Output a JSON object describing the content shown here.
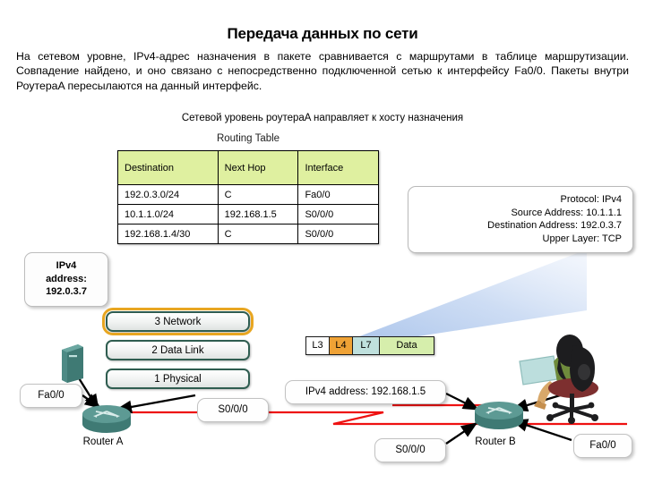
{
  "slide": {
    "title": "Передача данных по сети",
    "paragraph": "На сетевом уровне, IPv4-адрес назначения в пакете сравнивается с маршрутами в таблице маршрутизации. Совпадение найдено, и оно связано с непосредственно подключенной сетью к интерфейсу Fa0/0. Пакеты внутри РоутераA пересылаются на данный интерфейс.",
    "caption": "Сетевой уровень роутераA направляет к хосту назначения"
  },
  "routing_table": {
    "caption": "Routing Table",
    "headers": [
      "Destination",
      "Next Hop",
      "Interface"
    ],
    "rows": [
      [
        "192.0.3.0/24",
        "C",
        "Fa0/0"
      ],
      [
        "10.1.1.0/24",
        "192.168.1.5",
        "S0/0/0"
      ],
      [
        "192.168.1.4/30",
        "C",
        "S0/0/0"
      ]
    ],
    "header_color": "#dff0a0"
  },
  "packet_info": {
    "lines": [
      "Protocol: IPv4",
      "Source Address: 10.1.1.1",
      "Destination Address: 192.0.3.7",
      "Upper Layer: TCP"
    ]
  },
  "ipv4_left": {
    "line1": "IPv4",
    "line2": "address:",
    "line3": "192.0.3.7"
  },
  "osi_stack": {
    "layers": [
      {
        "label": "3 Network",
        "highlighted": true,
        "highlight_color": "#e8a621"
      },
      {
        "label": "2 Data Link",
        "highlighted": false,
        "highlight_color": ""
      },
      {
        "label": "1 Physical",
        "highlighted": false,
        "highlight_color": ""
      }
    ]
  },
  "packet_bar": {
    "segments": [
      {
        "label": "L3",
        "color": "#fefefe"
      },
      {
        "label": "L4",
        "color": "#efa235"
      },
      {
        "label": "L7",
        "color": "#bfe0dd"
      },
      {
        "label": "Data",
        "color": "#d6eeac"
      }
    ]
  },
  "labels": {
    "fa00_left": "Fa0/0",
    "s000_left": "S0/0/0",
    "ipv4_right": "IPv4 address: 192.168.1.5",
    "s000_right": "S0/0/0",
    "fa00_right": "Fa0/0"
  },
  "devices": {
    "router_a": "Router A",
    "router_b": "Router B"
  },
  "colors": {
    "red_path": "#ee1111",
    "cone_blue": "#b9cdee",
    "router_teal": "#4d8a85",
    "host_teal": "#4d8a85"
  }
}
